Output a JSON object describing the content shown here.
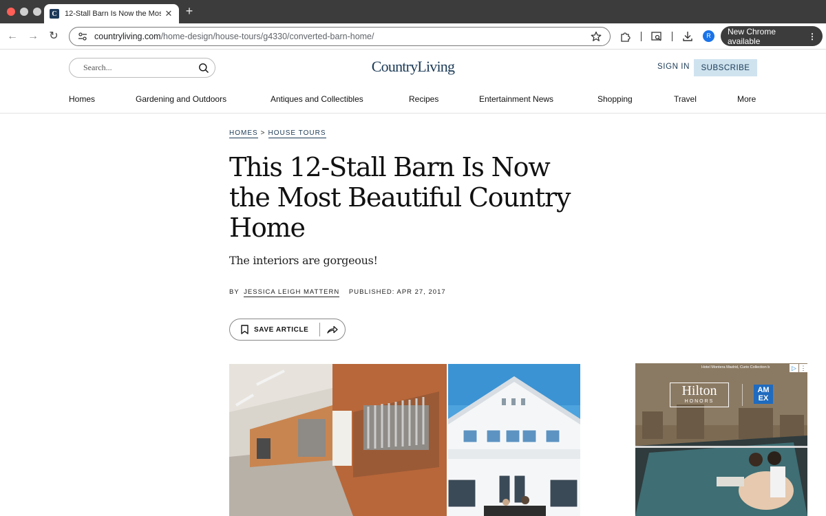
{
  "browser": {
    "tab_title": "12-Stall Barn Is Now the Most",
    "tab_favicon_letter": "C",
    "url_domain": "countryliving.com",
    "url_path": "/home-design/house-tours/g4330/converted-barn-home/",
    "profile_initial": "R",
    "update_label": "New Chrome available",
    "update_menu": "⋮"
  },
  "site": {
    "logo": "CountryLiving",
    "search_placeholder": "Search...",
    "sign_in": "SIGN IN",
    "subscribe": "SUBSCRIBE",
    "nav": [
      "Homes",
      "Gardening and Outdoors",
      "Antiques and Collectibles",
      "Recipes",
      "Entertainment News",
      "Shopping",
      "Travel",
      "More"
    ]
  },
  "article": {
    "breadcrumb": [
      "HOMES",
      "HOUSE TOURS"
    ],
    "breadcrumb_separator": ">",
    "headline": "This 12-Stall Barn Is Now the Most Beautiful Country Home",
    "dek": "The interiors are gorgeous!",
    "byline_prefix": "BY",
    "author": "JESSICA LEIGH MATTERN",
    "published": "PUBLISHED: APR 27, 2017",
    "save_label": "SAVE ARTICLE"
  },
  "ad": {
    "brand_main": "Hilton",
    "brand_sub": "HONORS",
    "partner": "AM EX",
    "location": "Hotel Montera Madrid, Curio Collection b",
    "choices_label": "▷",
    "more_label": "⋮"
  },
  "colors": {
    "brand_navy": "#1b3a56",
    "subscribe_bg": "#cfe3ef",
    "tab_strip": "#3c3c3c"
  }
}
